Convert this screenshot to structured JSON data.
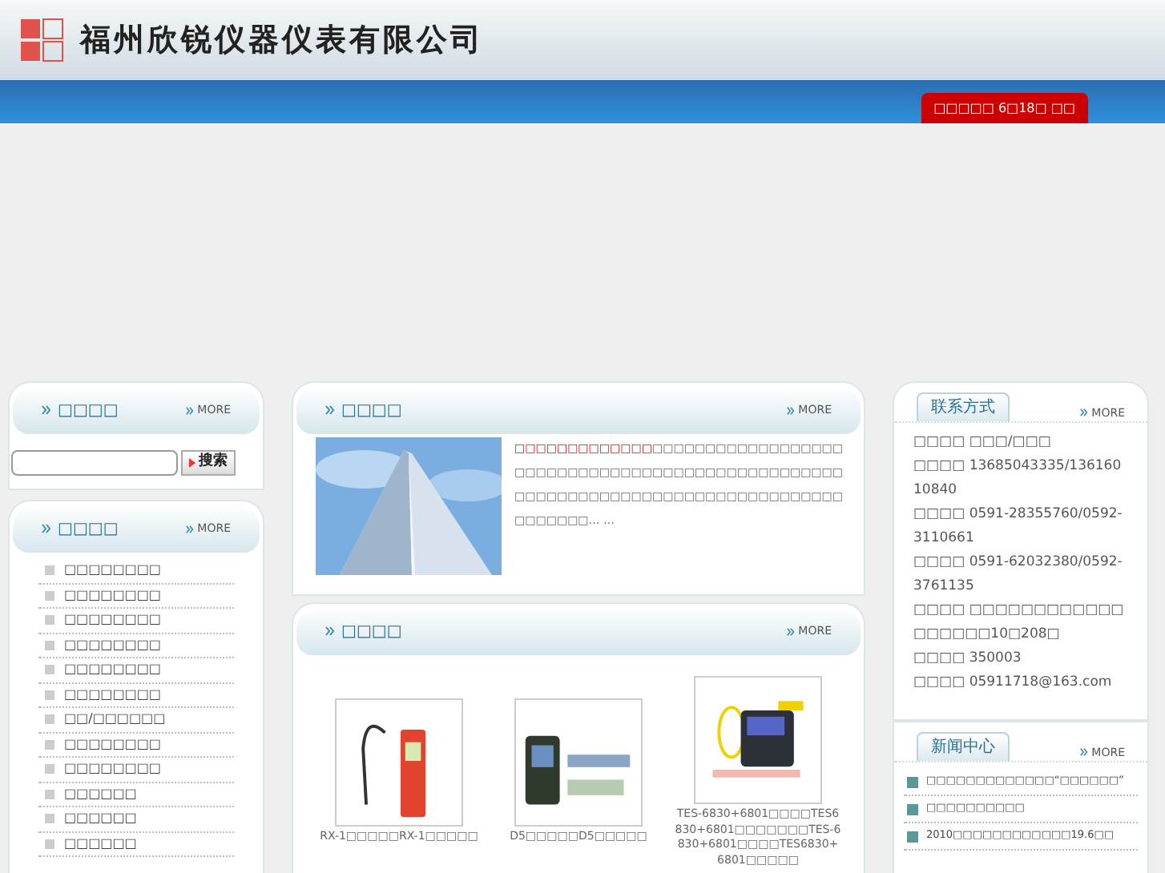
{
  "header": {
    "company": "福州欣锐仪器仪表有限公司",
    "notice": "□□□□□ 6□18□ □□"
  },
  "search_box": {
    "title": "□□□□",
    "more": "MORE",
    "button": "搜索"
  },
  "categories": {
    "title": "□□□□",
    "more": "MORE",
    "items": [
      "□□□□□□□□",
      "□□□□□□□□",
      "□□□□□□□□",
      "□□□□□□□□",
      "□□□□□□□□",
      "□□□□□□□□",
      "□□/□□□□□□",
      "□□□□□□□□",
      "□□□□□□□□",
      "□□□□□□",
      "□□□□□□",
      "□□□□□□"
    ]
  },
  "about": {
    "title": "□□□□",
    "more": "MORE",
    "highlight": "□□□□□□□□□□□□□",
    "text": "□□□□□□□□□□□□□□□□□□□□□□□□□□□□□□□□□□□□□□□□□□□□□□□□□□□□□□□□□□□□□□□□□□□□□□□□□□□□□□□□□□□□□□□… …"
  },
  "products": {
    "title": "□□□□",
    "more": "MORE",
    "items": [
      {
        "name": "RX-1□□□□□RX-1□□□□□",
        "kind": "detector"
      },
      {
        "name": "D5□□□□□D5□□□□□",
        "kind": "meter"
      },
      {
        "name": "TES-6830+6801□□□□TES6830+6801□□□□□□□TES-6830+6801□□□□TES6830+6801□□□□□",
        "kind": "analyzer"
      }
    ]
  },
  "contact": {
    "title": "联系方式",
    "more": "MORE",
    "lines": [
      "□□□□ □□□/□□□",
      "□□□□ 13685043335/13616010840",
      "□□□□ 0591-28355760/0592-3110661",
      "□□□□ 0591-62032380/0592-3761135",
      "□□□□ □□□□□□□□□□□□□□□□□□10□208□",
      "□□□□ 350003",
      "□□□□ 05911718@163.com"
    ]
  },
  "news": {
    "title": "新闻中心",
    "more": "MORE",
    "items": [
      "□□□□□□□□□□□□□“□□□□□□”",
      "□□□□□□□□□□",
      "2010□□□□□□□□□□□□19.6□□"
    ]
  }
}
